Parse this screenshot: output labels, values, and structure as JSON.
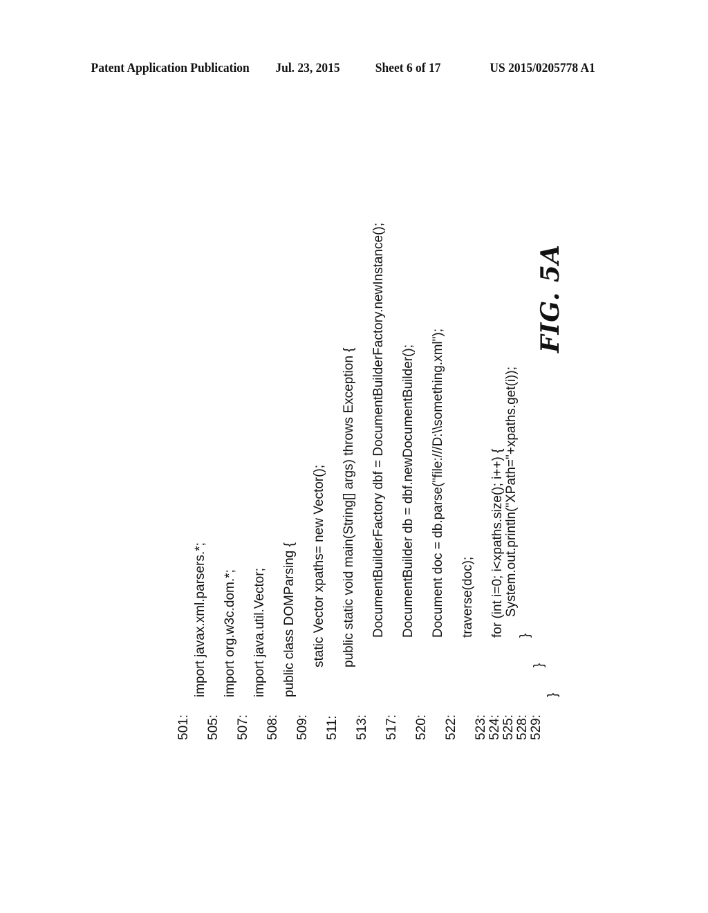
{
  "header": {
    "publication": "Patent Application Publication",
    "date": "Jul. 23, 2015",
    "sheet": "Sheet 6 of 17",
    "number": "US 2015/0205778 A1"
  },
  "code_lines": [
    {
      "num": "501:",
      "text": "import javax.xml.parsers.*;"
    },
    {
      "num": "505:",
      "text": "import org.w3c.dom.*;"
    },
    {
      "num": "507:",
      "text": "import java.util.Vector;"
    },
    {
      "num": "508:",
      "text": "public class DOMParsing {"
    },
    {
      "num": "509:",
      "text": "static Vector xpaths= new Vector();"
    },
    {
      "num": "511:",
      "text": "public static void main(String[] args) throws Exception {"
    },
    {
      "num": "513:",
      "text": "DocumentBuilderFactory dbf = DocumentBuilderFactory.newInstance();"
    },
    {
      "num": "517:",
      "text": "DocumentBuilder db = dbf.newDocumentBuilder();"
    },
    {
      "num": "520:",
      "text": "Document doc = db.parse(\"file:///D:\\\\something.xml\");"
    },
    {
      "num": "522:",
      "text": "traverse(doc);"
    },
    {
      "num": "523:",
      "text": "for (int i=0; i<xpaths.size(); i++) {"
    },
    {
      "num": "524:",
      "text": "System.out.println(\"XPath=\"+xpaths.get(i));"
    },
    {
      "num": "525:",
      "text": "}"
    },
    {
      "num": "528:",
      "text": "}"
    },
    {
      "num": "529:",
      "text": "}"
    }
  ],
  "figure_label": "FIG. 5A"
}
